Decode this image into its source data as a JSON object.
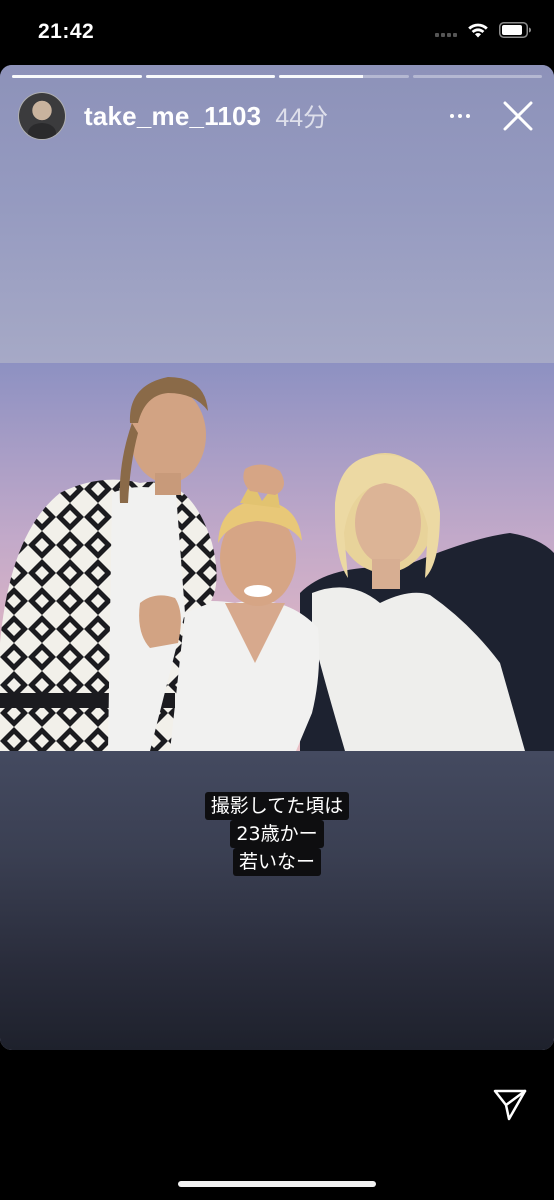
{
  "status_bar": {
    "time": "21:42",
    "icons": [
      "cellular-signal-icon",
      "wifi-icon",
      "battery-icon"
    ]
  },
  "story": {
    "progress": [
      1.0,
      1.0,
      0.65,
      0.0
    ],
    "header": {
      "username": "take_me_1103",
      "timestamp": "44分",
      "avatar": "avatar",
      "icons": [
        "more-options-icon",
        "close-icon"
      ]
    },
    "photo": {
      "subject": "three young men in white shirts posing against a pastel sky",
      "palette": {
        "sky_top": "#8d90c0",
        "sky_bottom": "#e0b8c6",
        "shirt": "#f1f1f0",
        "blond_hair": "#e8d39a",
        "dark_jacket": "#1d2230"
      }
    },
    "caption_lines": [
      "撮影してた頃は",
      "23歳かー",
      "若いなー"
    ]
  },
  "bottom": {
    "send_icon": "send-icon"
  },
  "colors": {
    "background": "#000000",
    "story_top": "#8d92b9",
    "story_bottom": "#1e212c",
    "caption_bg": "#0e0e10",
    "text": "#ffffff"
  }
}
